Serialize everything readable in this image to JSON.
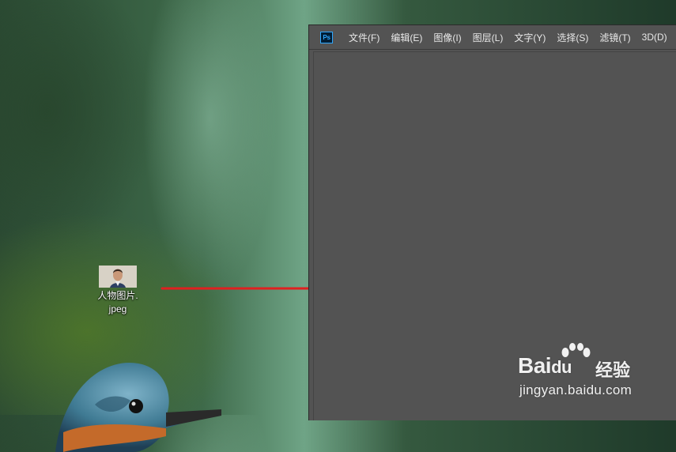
{
  "desktop": {
    "file_icon": {
      "name_line1": "人物图片.",
      "name_line2": "jpeg"
    }
  },
  "photoshop": {
    "logo_text": "Ps",
    "menu": [
      {
        "label": "文件(F)"
      },
      {
        "label": "编辑(E)"
      },
      {
        "label": "图像(I)"
      },
      {
        "label": "图层(L)"
      },
      {
        "label": "文字(Y)"
      },
      {
        "label": "选择(S)"
      },
      {
        "label": "滤镜(T)"
      },
      {
        "label": "3D(D)"
      }
    ]
  },
  "annotation": {
    "arrow_color": "#e02020"
  },
  "watermark": {
    "brand": "Bai",
    "brand_suffix": "du",
    "cn": "经验",
    "url": "jingyan.baidu.com"
  }
}
